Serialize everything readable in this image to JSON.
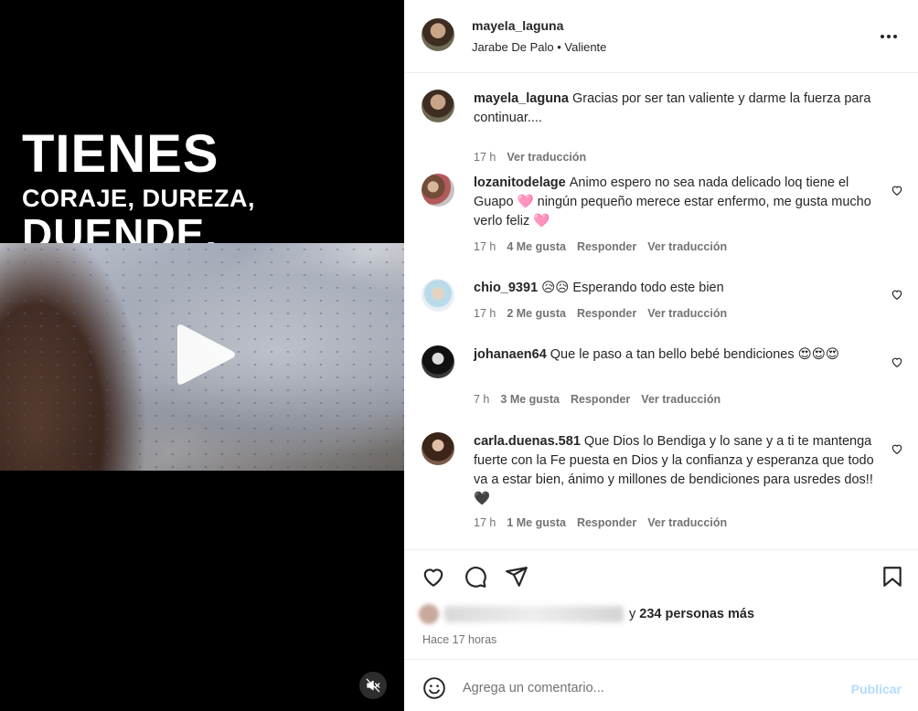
{
  "media": {
    "title_line1": "TIENES",
    "title_line2": "CORAJE, DUREZA,",
    "title_line3": "DUENDE,"
  },
  "header": {
    "username": "mayela_laguna",
    "audio": "Jarabe De Palo • Valiente"
  },
  "comments": [
    {
      "username": "mayela_laguna",
      "text": "Gracias por ser tan valiente y darme la fuerza para continuar....",
      "time": "17 h",
      "likes": "",
      "reply": "",
      "translate": "Ver traducción"
    },
    {
      "username": "lozanitodelage",
      "text": "Animo espero no sea nada delicado loq tiene el Guapo 🩷 ningún pequeño merece estar enfermo, me gusta mucho verlo feliz 🩷",
      "time": "17 h",
      "likes": "4 Me gusta",
      "reply": "Responder",
      "translate": "Ver traducción"
    },
    {
      "username": "chio_9391",
      "text": "😥😥 Esperando todo este bien",
      "time": "17 h",
      "likes": "2 Me gusta",
      "reply": "Responder",
      "translate": "Ver traducción"
    },
    {
      "username": "johanaen64",
      "text": "Que le paso a tan bello bebé bendiciones 😍😍😍",
      "time": "7 h",
      "likes": "3 Me gusta",
      "reply": "Responder",
      "translate": "Ver traducción"
    },
    {
      "username": "carla.duenas.581",
      "text": "Que Dios lo Bendiga y lo sane y a ti te mantenga fuerte con la Fe puesta en Dios y la confianza y esperanza que todo va a estar bien, ánimo y millones de bendiciones para usredes dos!! 🖤",
      "time": "17 h",
      "likes": "1 Me gusta",
      "reply": "Responder",
      "translate": "Ver traducción"
    }
  ],
  "likes": {
    "prefix": "y",
    "count": "234 personas más"
  },
  "timestamp": "Hace 17 horas",
  "composer": {
    "placeholder": "Agrega un comentario...",
    "post_label": "Publicar"
  },
  "icons": {
    "like": "heart-icon",
    "comment": "comment-icon",
    "share": "share-icon",
    "save": "bookmark-icon",
    "emoji": "emoji-icon",
    "mute": "muted-speaker-icon",
    "play": "play-icon",
    "more": "more-options-icon"
  },
  "colors": {
    "post_button": "#b3dbff",
    "muted_text": "#737373",
    "text": "#262626"
  }
}
